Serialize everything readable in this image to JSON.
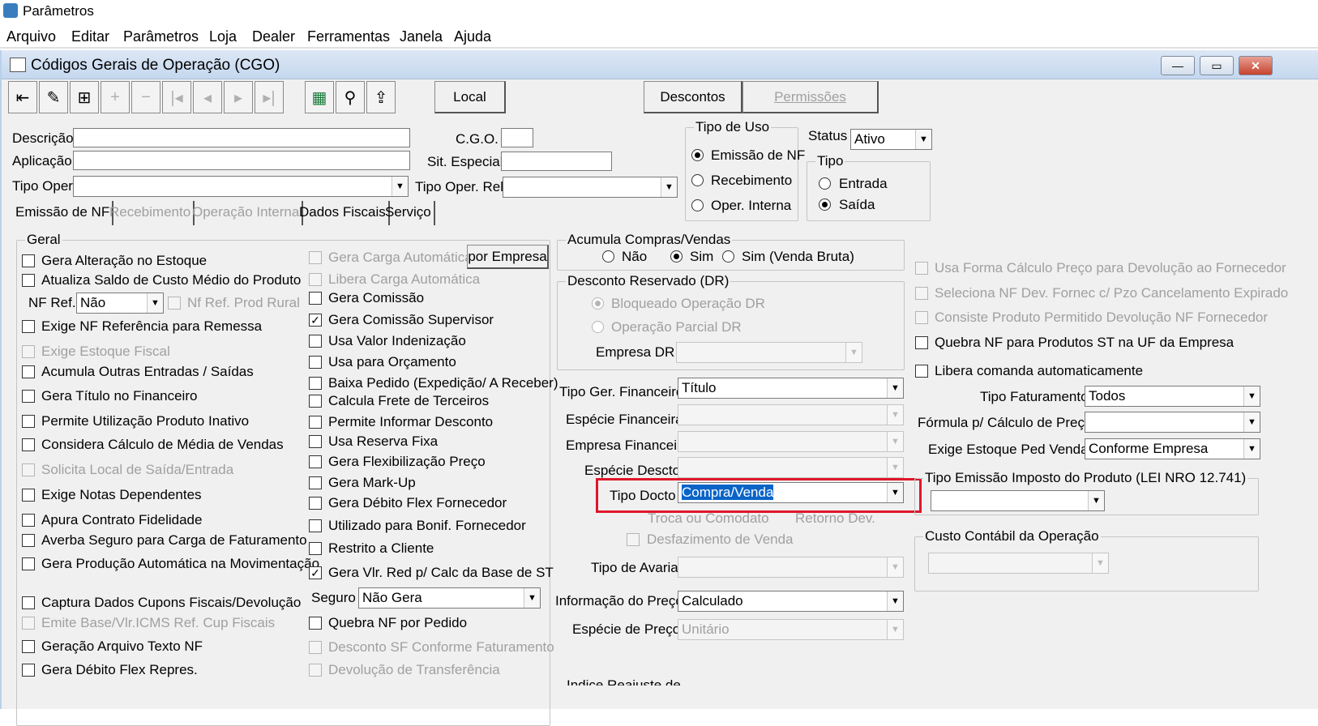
{
  "app": {
    "title": "Parâmetros"
  },
  "menu": [
    "Arquivo",
    "Editar",
    "Parâmetros",
    "Loja",
    "Dealer",
    "Ferramentas",
    "Janela",
    "Ajuda"
  ],
  "window": {
    "title": "Códigos Gerais de Operação (CGO)",
    "min": "—",
    "max": "▭",
    "close": "✕"
  },
  "toolbar": {
    "local": "Local",
    "descontos": "Descontos",
    "permissoes": "Permissões"
  },
  "form": {
    "descricao": "Descrição",
    "aplicacao": "Aplicação",
    "tipo_oper": "Tipo Oper.",
    "cgo": "C.G.O.",
    "sit_especial": "Sit. Especial",
    "tipo_oper_rel": "Tipo Oper. Rel.",
    "tipo_uso": {
      "title": "Tipo de Uso",
      "options": [
        "Emissão de NF",
        "Recebimento",
        "Oper. Interna"
      ]
    },
    "status": {
      "label": "Status",
      "value": "Ativo"
    },
    "tipo": {
      "title": "Tipo",
      "options": [
        "Entrada",
        "Saída"
      ]
    }
  },
  "tabs": [
    "Emissão de NF",
    "Recebimento",
    "Operação Interna",
    "Dados Fiscais",
    "Serviço"
  ],
  "geral": {
    "title": "Geral",
    "col1": [
      "Gera Alteração no Estoque",
      "Atualiza Saldo de Custo Médio do Produto",
      "Exige NF Referência para Remessa",
      "Exige Estoque Fiscal",
      "Acumula Outras Entradas / Saídas",
      "Gera Título no Financeiro",
      "Permite Utilização Produto Inativo",
      "Considera Cálculo de Média de Vendas",
      "Solicita Local de Saída/Entrada",
      "Exige Notas Dependentes",
      "Apura Contrato Fidelidade",
      "Averba Seguro para Carga de Faturamento",
      "Gera Produção Automática na Movimentação",
      "Captura Dados Cupons Fiscais/Devolução",
      "Emite Base/Vlr.ICMS Ref. Cup Fiscais",
      "Geração Arquivo Texto NF",
      "Gera Débito Flex Repres."
    ],
    "nf_ref_label": "NF Ref.",
    "nf_ref_value": "Não",
    "nf_ref_prod_rural": "Nf Ref. Prod Rural",
    "col2": [
      "Gera Carga Automática",
      "Libera Carga Automática",
      "Gera Comissão",
      "Gera Comissão Supervisor",
      "Usa Valor Indenização",
      "Usa para Orçamento",
      "Baixa Pedido (Expedição/ A Receber)",
      "Calcula Frete de Terceiros",
      "Permite Informar Desconto",
      "Usa Reserva Fixa",
      "Gera Flexibilização Preço",
      "Gera Mark-Up",
      "Gera Débito Flex Fornecedor",
      "Utilizado para Bonif. Fornecedor",
      "Restrito a Cliente",
      "Gera Vlr. Red p/ Calc da Base de ST",
      "Quebra NF por Pedido",
      "Desconto SF Conforme Faturamento",
      "Devolução de Transferência"
    ],
    "por_empresa": "por Empresa",
    "seguro_label": "Seguro",
    "seguro_value": "Não Gera"
  },
  "mid": {
    "acumula": {
      "title": "Acumula Compras/Vendas",
      "options": [
        "Não",
        "Sim",
        "Sim (Venda Bruta)"
      ]
    },
    "desconto_dr": {
      "title": "Desconto Reservado (DR)",
      "options": [
        "Bloqueado Operação DR",
        "Operação Parcial DR"
      ],
      "empresa_dr": "Empresa DR"
    },
    "tipo_ger_fin": {
      "label": "Tipo Ger. Financeiro",
      "value": "Título"
    },
    "especie_fin": "Espécie Financeira",
    "empresa_fin": "Empresa Financeiro",
    "especie_descto": "Espécie Descto",
    "tipo_docto": {
      "label": "Tipo Docto",
      "value": "Compra/Venda"
    },
    "troca": "Troca ou Comodato",
    "retorno": "Retorno Dev.",
    "desfazimento": "Desfazimento de Venda",
    "tipo_avaria": "Tipo de Avaria",
    "info_preco": {
      "label": "Informação do Preço",
      "value": "Calculado"
    },
    "especie_preco": {
      "label": "Espécie de Preço",
      "value": "Unitário"
    },
    "indice": "Indice Reajuste de..."
  },
  "right": {
    "checks": [
      "Usa Forma Cálculo Preço para Devolução ao Fornecedor",
      "Seleciona NF Dev. Fornec c/ Pzo Cancelamento Expirado",
      "Consiste Produto Permitido Devolução NF Fornecedor",
      "Quebra NF para Produtos ST na UF da Empresa",
      "Libera comanda automaticamente"
    ],
    "tipo_fat": {
      "label": "Tipo Faturamento",
      "value": "Todos"
    },
    "formula": {
      "label": "Fórmula p/ Cálculo de Preço",
      "value": ""
    },
    "exige_estoque": {
      "label": "Exige Estoque Ped Venda",
      "value": "Conforme Empresa"
    },
    "tipo_emissao": "Tipo Emissão Imposto do Produto (LEI NRO 12.741)",
    "custo_contabil": "Custo Contábil da Operação"
  }
}
